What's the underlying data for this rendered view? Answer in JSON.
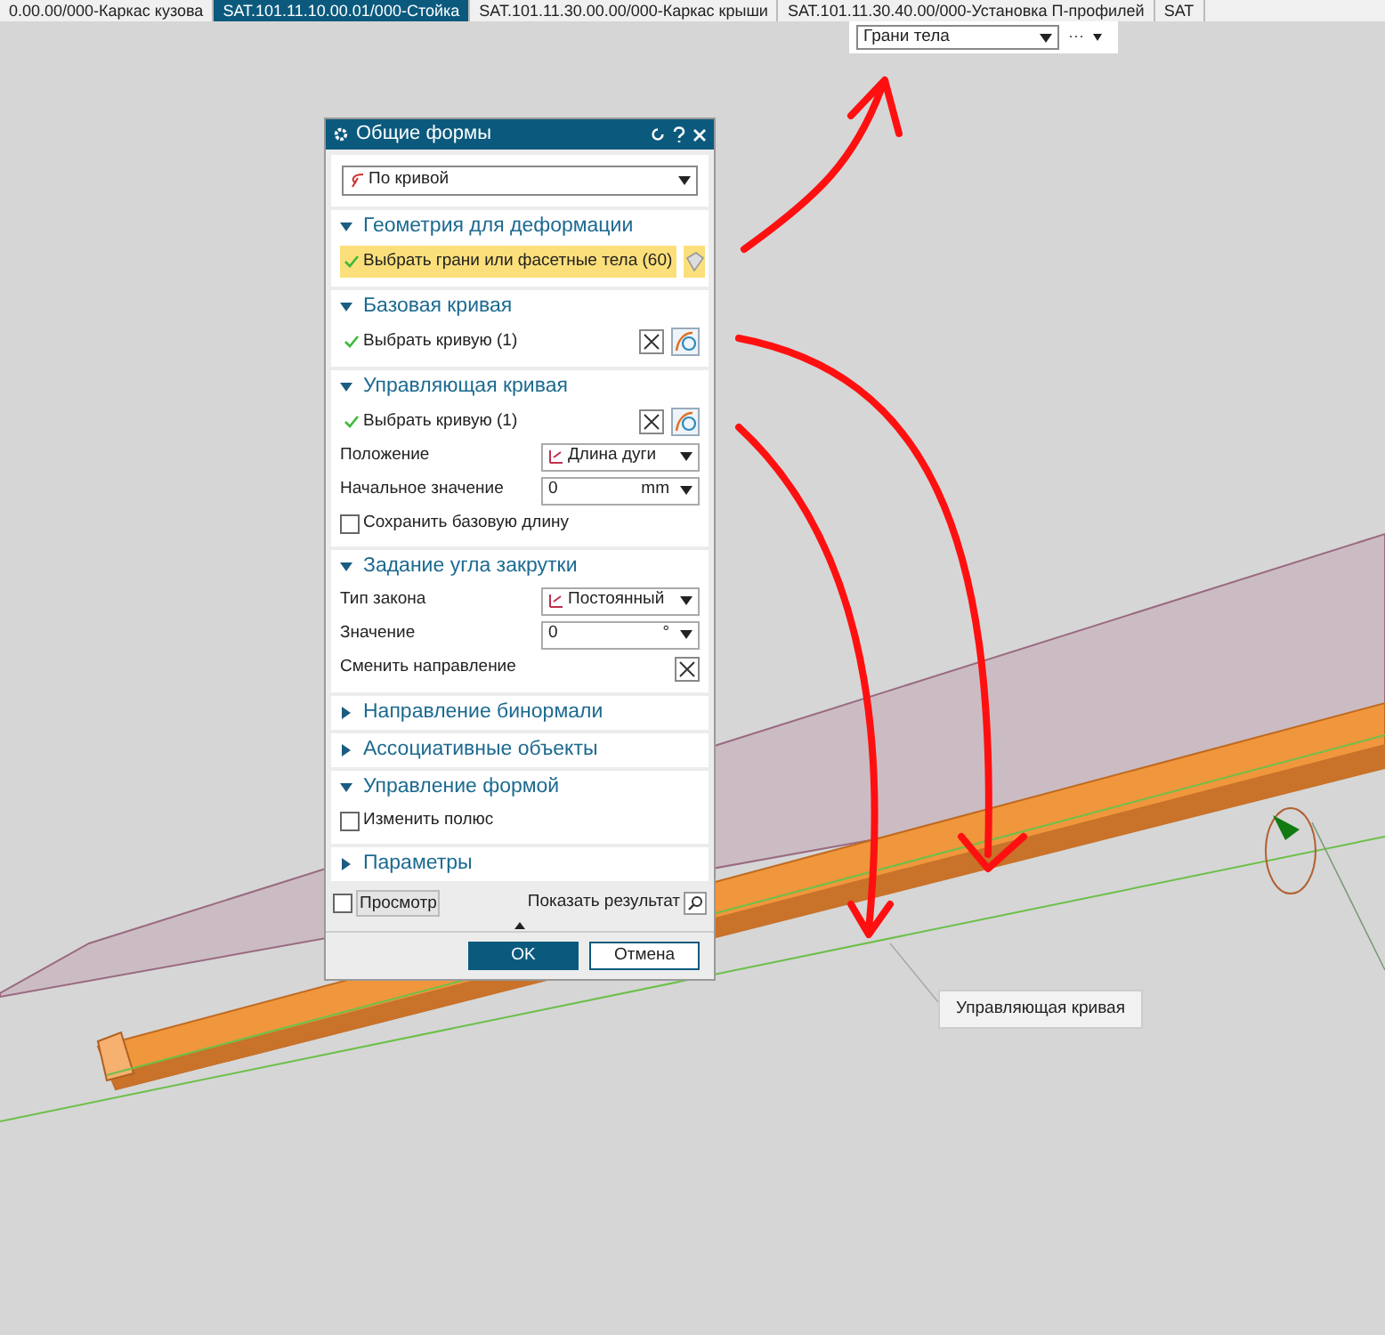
{
  "tabs": [
    {
      "label": "0.00.00/000-Каркас кузова",
      "selected": false
    },
    {
      "label": "SAT.101.11.10.00.01/000-Стойка",
      "selected": true
    },
    {
      "label": "SAT.101.11.30.00.00/000-Каркас крыши",
      "selected": false
    },
    {
      "label": "SAT.101.11.30.40.00/000-Установка П-профилей",
      "selected": false
    },
    {
      "label": "SAT",
      "selected": false
    }
  ],
  "selection_filter": {
    "value": "Грани тела",
    "more": "···"
  },
  "dialog": {
    "title": "Общие формы",
    "type_value": "По кривой",
    "sections": [
      {
        "title": "Геометрия для деформации",
        "expanded": true,
        "rows": [
          {
            "kind": "selection",
            "label": "Выбрать грани или фасетные тела (60)",
            "highlighted": true,
            "done": true
          }
        ]
      },
      {
        "title": "Базовая кривая",
        "expanded": true,
        "rows": [
          {
            "kind": "selection",
            "label": "Выбрать кривую (1)",
            "highlighted": false,
            "done": true
          }
        ]
      },
      {
        "title": "Управляющая кривая",
        "expanded": true,
        "rows": [
          {
            "kind": "selection",
            "label": "Выбрать кривую (1)",
            "highlighted": false,
            "done": true
          },
          {
            "kind": "dropdown",
            "label": "Положение",
            "value": "Длина дуги"
          },
          {
            "kind": "number",
            "label": "Начальное значение",
            "value": "0",
            "unit": "mm"
          },
          {
            "kind": "checkbox",
            "label": "Сохранить базовую длину",
            "checked": false
          }
        ]
      },
      {
        "title": "Задание угла закрутки",
        "expanded": true,
        "rows": [
          {
            "kind": "dropdown",
            "label": "Тип закона",
            "value": "Постоянный"
          },
          {
            "kind": "number",
            "label": "Значение",
            "value": "0",
            "unit": "°"
          },
          {
            "kind": "action",
            "label": "Сменить направление"
          }
        ]
      },
      {
        "title": "Направление бинормали",
        "expanded": false
      },
      {
        "title": "Ассоциативные объекты",
        "expanded": false
      },
      {
        "title": "Управление формой",
        "expanded": true,
        "rows": [
          {
            "kind": "checkbox",
            "label": "Изменить полюс",
            "checked": false
          }
        ]
      },
      {
        "title": "Параметры",
        "expanded": false
      }
    ],
    "preview": {
      "label": "Просмотр",
      "checked": false
    },
    "show_result": "Показать результат",
    "ok": "OK",
    "cancel": "Отмена"
  },
  "callout": "Управляющая кривая"
}
